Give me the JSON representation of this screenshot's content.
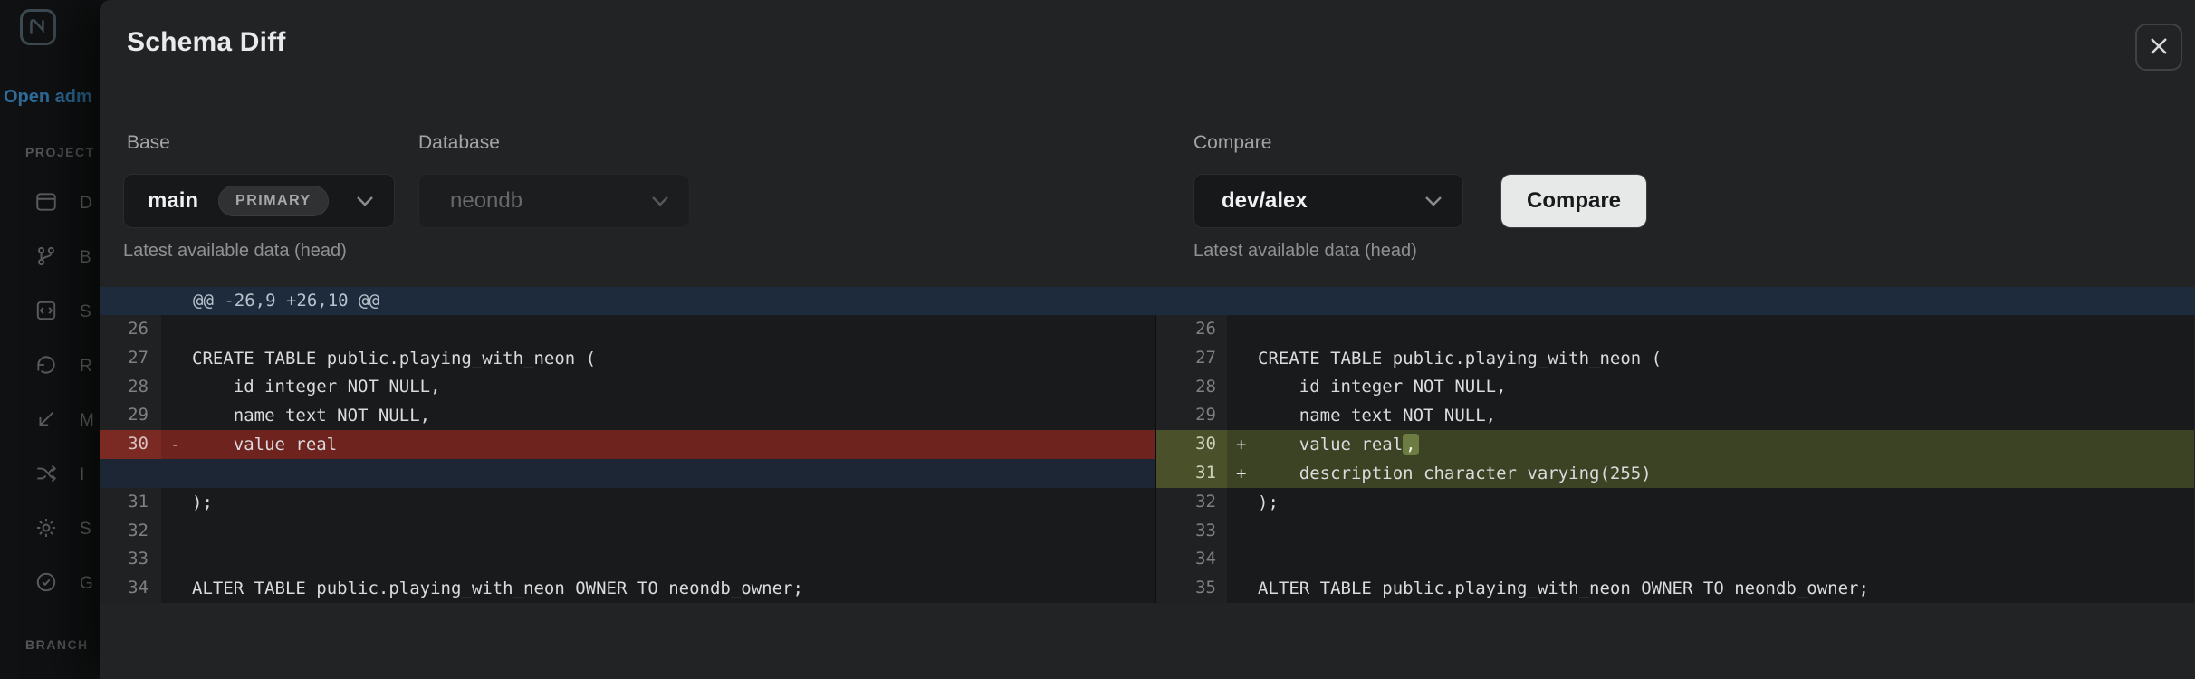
{
  "sidebar": {
    "open_link": "Open adm",
    "project_label": "PROJECT",
    "branch_label": "BRANCH",
    "items": [
      {
        "icon": "dashboard-icon",
        "label": "D"
      },
      {
        "icon": "branches-icon",
        "label": "B"
      },
      {
        "icon": "sql-editor-icon",
        "label": "S"
      },
      {
        "icon": "restore-icon",
        "label": "R"
      },
      {
        "icon": "monitoring-icon",
        "label": "M"
      },
      {
        "icon": "integrations-icon",
        "label": "I"
      },
      {
        "icon": "settings-icon",
        "label": "S"
      },
      {
        "icon": "get-started-icon",
        "label": "G"
      }
    ]
  },
  "modal": {
    "title": "Schema Diff"
  },
  "controls": {
    "base": {
      "label": "Base",
      "value": "main",
      "badge": "PRIMARY",
      "hint": "Latest available data (head)"
    },
    "database": {
      "label": "Database",
      "value": "neondb"
    },
    "compare": {
      "label": "Compare",
      "value": "dev/alex",
      "button_label": "Compare",
      "hint": "Latest available data (head)"
    }
  },
  "diff": {
    "hunk_header": "@@ -26,9 +26,10 @@",
    "left_rows": [
      {
        "num": "26",
        "sign": "",
        "text": "",
        "type": "context"
      },
      {
        "num": "27",
        "sign": "",
        "text": "CREATE TABLE public.playing_with_neon (",
        "type": "context"
      },
      {
        "num": "28",
        "sign": "",
        "text": "    id integer NOT NULL,",
        "type": "context"
      },
      {
        "num": "29",
        "sign": "",
        "text": "    name text NOT NULL,",
        "type": "context"
      },
      {
        "num": "30",
        "sign": "-",
        "text": "    value real",
        "type": "removed"
      },
      {
        "num": "",
        "sign": "",
        "text": "",
        "type": "filler"
      },
      {
        "num": "31",
        "sign": "",
        "text": ");",
        "type": "context"
      },
      {
        "num": "32",
        "sign": "",
        "text": "",
        "type": "context"
      },
      {
        "num": "33",
        "sign": "",
        "text": "",
        "type": "context"
      },
      {
        "num": "34",
        "sign": "",
        "text": "ALTER TABLE public.playing_with_neon OWNER TO neondb_owner;",
        "type": "context"
      }
    ],
    "right_rows": [
      {
        "num": "26",
        "sign": "",
        "text": "",
        "type": "context"
      },
      {
        "num": "27",
        "sign": "",
        "text": "CREATE TABLE public.playing_with_neon (",
        "type": "context"
      },
      {
        "num": "28",
        "sign": "",
        "text": "    id integer NOT NULL,",
        "type": "context"
      },
      {
        "num": "29",
        "sign": "",
        "text": "    name text NOT NULL,",
        "type": "context"
      },
      {
        "num": "30",
        "sign": "+",
        "text": "    value real",
        "highlight": ",",
        "type": "added"
      },
      {
        "num": "31",
        "sign": "+",
        "text": "    description character varying(255)",
        "type": "added"
      },
      {
        "num": "32",
        "sign": "",
        "text": ");",
        "type": "context"
      },
      {
        "num": "33",
        "sign": "",
        "text": "",
        "type": "context"
      },
      {
        "num": "34",
        "sign": "",
        "text": "",
        "type": "context"
      },
      {
        "num": "35",
        "sign": "",
        "text": "ALTER TABLE public.playing_with_neon OWNER TO neondb_owner;",
        "type": "context"
      }
    ]
  },
  "colors": {
    "removed_bg": "#6f231f",
    "added_bg": "#3c4325",
    "filler_bg": "#1c2635",
    "hunk_bar_bg": "#1d2b3c",
    "accent_link": "#2e6d9c",
    "button_bg": "#e7e8e8"
  }
}
